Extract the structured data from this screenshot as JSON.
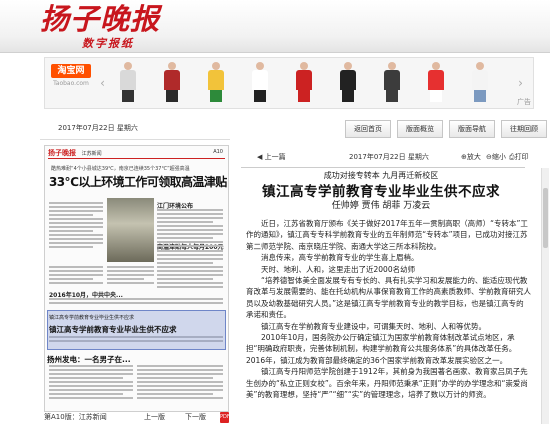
{
  "header": {
    "logo": "扬子晚报",
    "sub": "数字报纸"
  },
  "ad": {
    "brand_line1": "淘宝网",
    "brand_line2": "Taobao.com",
    "items": [
      {
        "body": "#d9d9d9",
        "legs": "#333333"
      },
      {
        "body": "#b02a2a",
        "legs": "#2b2b2b"
      },
      {
        "body": "#f2c33a",
        "legs": "#2d8a3a"
      },
      {
        "body": "#ffffff",
        "legs": "#222222"
      },
      {
        "body": "#cc2222",
        "legs": "#cc2222"
      },
      {
        "body": "#222222",
        "legs": "#222222"
      },
      {
        "body": "#3c3c3c",
        "legs": "#3c3c3c"
      },
      {
        "body": "#e63030",
        "legs": "#ffffff"
      },
      {
        "body": "#f4f4f4",
        "legs": "#7c9ac0"
      }
    ],
    "label": "广告"
  },
  "left": {
    "date": "2017年07月22日 星期六",
    "paper": {
      "masthead": "扬子晚报",
      "section": "江苏新闻",
      "page": "A10",
      "sub": "酷热难耐“4个小县城达39℃，南京已连续35个37℃”超强高温",
      "big": "33℃以上环境工作可领取高温津贴",
      "col1": "2016年10月，中共中央...",
      "col2": "江门环境公布",
      "col3": "高温津贴每人每月200元",
      "t2s": "镇江高专学前教育专业毕业生供不应求",
      "t2": "镇江高专学前教育专业毕业生供不应求",
      "t3": "扬州发电：一名男子在..."
    },
    "pagebar": {
      "label": "第A10版：江苏新闻",
      "prev": "上一版",
      "next": "下一版"
    }
  },
  "right": {
    "buttons": [
      "返回首页",
      "版面概览",
      "版面导航",
      "往期回顾"
    ],
    "articlebar": {
      "prev": "上一篇",
      "date": "2017年07月22日 星期六",
      "zoom_in": "放大",
      "zoom_out": "缩小",
      "print": "打印"
    },
    "article": {
      "kicker": "成功对接专转本 九月再迁新校区",
      "headline": "镇江高专学前教育专业毕业生供不应求",
      "byline": "任帅婷  贾伟  胡菲  万凌云",
      "paragraphs": [
        "近日，江苏省教育厅颁布《关于做好2017年五年一贯制高职（高师）“专转本”工作的通知》，镇江高专专科学前教育专业的五年制师范“专转本”项目，已成功对接江苏第二师范学院、南京晓庄学院、南通大学这三所本科院校。",
        "消息传来，高专学前教育专业的学生喜上眉梢。",
        "天时、地利、人和，这里走出了近2000名幼师",
        "“培养德智体美全面发展专有专长的、具有扎实学习和发展能力的、能适应现代教育改革与发展需要的、能在托幼机构从事保育教育工作的高素质教师、学前教育研究人员以及幼教基础研究人员。”这是镇江高专学前教育专业的教学目标，也是镇江高专的承诺和责任。",
        "镇江高专在学前教育专业建设中，可谓集天时、地利、人和等优势。",
        "2010年10月，国务院办公厅确定镇江为国家学前教育体制改革试点地区，承担“明确政府职责，完善体制机制，构建学前教育公共服务体系”的具体改革任务。2016年，镇江成为教育部最终确定的36个国家学前教育改革发展实验区之一。",
        "镇江高专丹阳师范学院创建于1912年，其前身为我国著名画家、教育家吕凤子先生创办的“私立正则女校”。百余年来，丹阳师范秉承“正则”办学的办学理念和“崇爱尚美”的教育理想，坚持“严”“细”“实”的管理理念，培养了数以万计的师资。"
      ]
    }
  }
}
